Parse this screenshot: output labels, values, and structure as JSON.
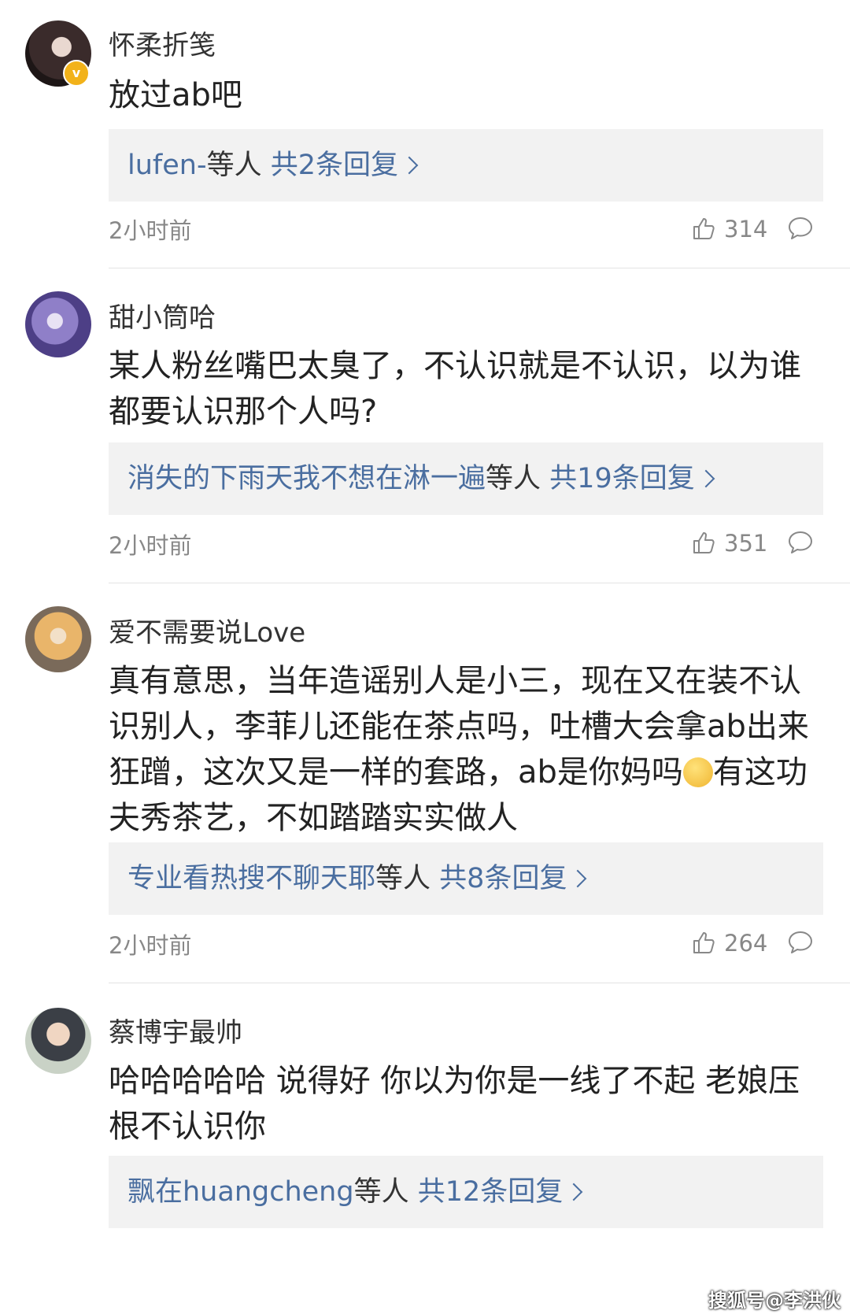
{
  "comments": [
    {
      "username": "怀柔折笺",
      "text": "放过ab吧",
      "reply_users": "lufen-",
      "reply_mid": "等人",
      "reply_count": "共2条回复",
      "time": "2小时前",
      "likes": "314",
      "verified": true
    },
    {
      "username": "甜小筒哈",
      "text": "某人粉丝嘴巴太臭了，不认识就是不认识，以为谁都要认识那个人吗?",
      "reply_users": "消失的下雨天我不想在淋一遍",
      "reply_mid": "等人",
      "reply_count": "共19条回复",
      "time": "2小时前",
      "likes": "351"
    },
    {
      "username": "爱不需要说Love",
      "text_a": "真有意思，当年造谣别人是小三，现在又在装不认识别人，李菲儿还能在茶点吗，吐槽大会拿ab出来狂蹭，这次又是一样的套路，ab是你妈吗",
      "text_b": "有这功夫秀茶艺，不如踏踏实实做人",
      "reply_users": "专业看热搜不聊天耶",
      "reply_mid": "等人",
      "reply_count": "共8条回复",
      "time": "2小时前",
      "likes": "264"
    },
    {
      "username": "蔡博宇最帅",
      "text": "哈哈哈哈哈 说得好 你以为你是一线了不起 老娘压根不认识你",
      "reply_users": "飘在huangcheng",
      "reply_mid": "等人",
      "reply_count": "共12条回复"
    }
  ],
  "watermark": "搜狐号@李洪伙",
  "icons": {
    "like": "thumbs-up-icon",
    "reply": "comment-bubble-icon",
    "verified": "verified-badge-icon",
    "emoji": "thinking-face-emoji"
  }
}
